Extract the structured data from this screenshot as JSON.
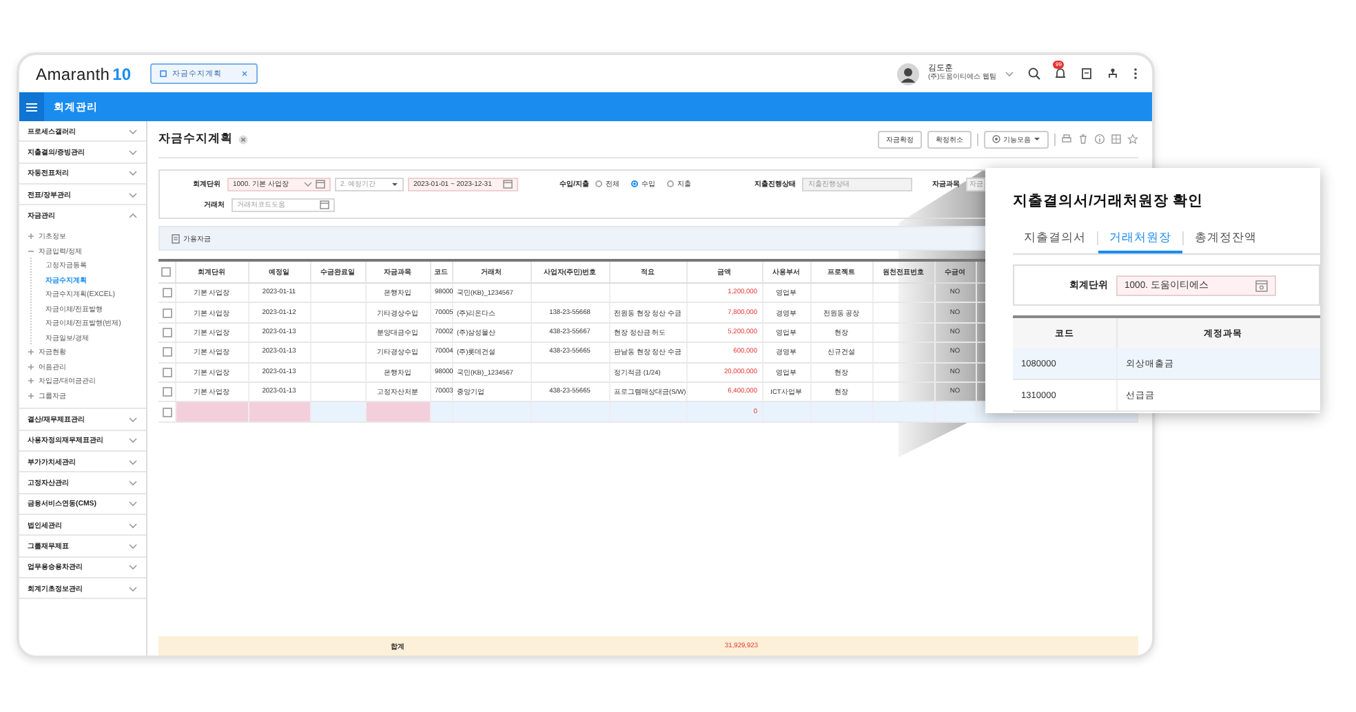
{
  "logo": {
    "name": "Amaranth",
    "version": "10"
  },
  "open_tabs": [
    {
      "label": "자금수지계획",
      "selected": true
    }
  ],
  "user": {
    "name": "김도훈",
    "company": "(주)도움이티에스 웹팀"
  },
  "notification_badge": "99",
  "menu_bar": {
    "title": "회계관리"
  },
  "sidebar": {
    "items": [
      {
        "label": "프로세스갤러리",
        "expanded": false
      },
      {
        "label": "지출결의/증빙관리",
        "expanded": false
      },
      {
        "label": "자동전표처리",
        "expanded": false
      },
      {
        "label": "전표/장부관리",
        "expanded": false
      },
      {
        "label": "자금관리",
        "expanded": true,
        "children": [
          {
            "label": "기초정보",
            "expanded": false
          },
          {
            "label": "자금입력/정제",
            "expanded": true,
            "children": [
              {
                "label": "고정자금등록",
                "selected": false
              },
              {
                "label": "자금수지계획",
                "selected": true
              },
              {
                "label": "자금수지계획(EXCEL)",
                "selected": false
              },
              {
                "label": "자금이체/전표발행",
                "selected": false
              },
              {
                "label": "자금이체/전표발행(번제)",
                "selected": false
              },
              {
                "label": "자금일보/경제",
                "selected": false
              }
            ]
          },
          {
            "label": "자금현황",
            "expanded": false
          },
          {
            "label": "어음관리",
            "expanded": false
          },
          {
            "label": "차입금/대여금관리",
            "expanded": false
          },
          {
            "label": "그룹자금",
            "expanded": false
          }
        ]
      },
      {
        "label": "결산/재무제표관리",
        "expanded": false
      },
      {
        "label": "사용자정의재무제표관리",
        "expanded": false
      },
      {
        "label": "부가가치세관리",
        "expanded": false
      },
      {
        "label": "고정자산관리",
        "expanded": false
      },
      {
        "label": "금융서비스연동(CMS)",
        "expanded": false
      },
      {
        "label": "법인세관리",
        "expanded": false
      },
      {
        "label": "그룹재무제표",
        "expanded": false
      },
      {
        "label": "업무용승용차관리",
        "expanded": false
      },
      {
        "label": "회계기초정보관리",
        "expanded": false
      }
    ]
  },
  "page": {
    "title": "자금수지계획",
    "actions": [
      {
        "label": "자금확정",
        "kind": "button"
      },
      {
        "label": "확정취소",
        "kind": "button"
      },
      {
        "label": "기능모음",
        "kind": "menu"
      }
    ]
  },
  "search": {
    "unit": {
      "label": "회계단위",
      "value": "1000. 기본 사업장"
    },
    "period_type": {
      "value": "2. 예정기간"
    },
    "period": {
      "value": "2023-01-01 ~ 2023-12-31"
    },
    "flow": {
      "label": "수입/지출",
      "options": [
        {
          "label": "전체",
          "selected": false
        },
        {
          "label": "수입",
          "selected": true
        },
        {
          "label": "지출",
          "selected": false
        }
      ]
    },
    "status": {
      "label": "지출진행상태",
      "placeholder": "지출진행상태"
    },
    "fund_item": {
      "label": "자금과목",
      "placeholder": "자금"
    },
    "partner": {
      "label": "거래처",
      "placeholder": "거래처코드도움"
    }
  },
  "toolbar": {
    "button": "가용자금"
  },
  "table": {
    "all_checked": false,
    "columns": [
      {
        "label": "회계단위",
        "kind": "center",
        "required": true
      },
      {
        "label": "예정일",
        "kind": "center",
        "required": true
      },
      {
        "label": "수금완료일",
        "kind": "center",
        "required": false
      },
      {
        "label": "자금과목",
        "kind": "center",
        "required": true
      },
      {
        "label": "코드",
        "kind": "center",
        "required": false
      },
      {
        "label": "거래처",
        "kind": "text",
        "required": false
      },
      {
        "label": "사업자(주민)번호",
        "kind": "center",
        "required": false
      },
      {
        "label": "적요",
        "kind": "text",
        "required": false
      },
      {
        "label": "금액",
        "kind": "amount",
        "required": false
      },
      {
        "label": "사용부서",
        "kind": "center",
        "required": false
      },
      {
        "label": "프로젝트",
        "kind": "center",
        "required": false
      },
      {
        "label": "원천전표번호",
        "kind": "center",
        "required": false
      },
      {
        "label": "수금여",
        "kind": "center",
        "required": false
      }
    ],
    "rows": [
      {
        "checked": false,
        "cells": [
          "기본 사업장",
          "2023-01-11",
          "",
          "은행차입",
          "98000",
          "국민(KB)_1234567",
          "",
          "",
          "1,200,000",
          "영업부",
          "",
          "",
          "NO"
        ]
      },
      {
        "checked": false,
        "cells": [
          "기본 사업장",
          "2023-01-12",
          "",
          "기타경상수입",
          "70005",
          "(주)리온다스",
          "138-23-55668",
          "전원동 현장 정산 수금",
          "7,800,000",
          "경영부",
          "전원동 공장",
          "",
          "NO"
        ]
      },
      {
        "checked": false,
        "cells": [
          "기본 사업장",
          "2023-01-13",
          "",
          "분양대금수입",
          "70002",
          "(주)삼성물산",
          "438-23-55667",
          "현장 정산금 허도",
          "5,200,000",
          "영업부",
          "현장",
          "",
          "NO"
        ]
      },
      {
        "checked": false,
        "cells": [
          "기본 사업장",
          "2023-01-13",
          "",
          "기타경상수입",
          "70004",
          "(주)롯데건설",
          "438-23-55665",
          "판남동 현장 정산 수금",
          "600,000",
          "경영부",
          "신규건설",
          "",
          "NO"
        ]
      },
      {
        "checked": false,
        "cells": [
          "기본 사업장",
          "2023-01-13",
          "",
          "은행차입",
          "98000",
          "국민(KB)_1234567",
          "",
          "정기적금 (1/24)",
          "20,000,000",
          "영업부",
          "현장",
          "",
          "NO"
        ]
      },
      {
        "checked": false,
        "cells": [
          "기본 사업장",
          "2023-01-13",
          "",
          "고정자산처분",
          "70003",
          "중앙기업",
          "438-23-55665",
          "프로그램매상대금(S/W)",
          "6,400,000",
          "ICT사업부",
          "현장",
          "",
          "NO"
        ]
      }
    ],
    "new_row": {
      "checked": false,
      "amount": "0"
    },
    "total": {
      "label": "합계",
      "amount": "31,929,923"
    }
  },
  "popup": {
    "title": "지출결의서/거래처원장 확인",
    "tabs": [
      {
        "label": "지출결의서",
        "selected": false
      },
      {
        "label": "거래처원장",
        "selected": true
      },
      {
        "label": "총계정잔액",
        "selected": false
      }
    ],
    "unit": {
      "label": "회계단위",
      "value": "1000. 도움이티에스"
    },
    "columns": [
      "코드",
      "계정과목"
    ],
    "rows": [
      {
        "cells": [
          "1080000",
          "외상매출금"
        ],
        "selected": true
      },
      {
        "cells": [
          "1310000",
          "선급금"
        ],
        "selected": false
      }
    ]
  }
}
